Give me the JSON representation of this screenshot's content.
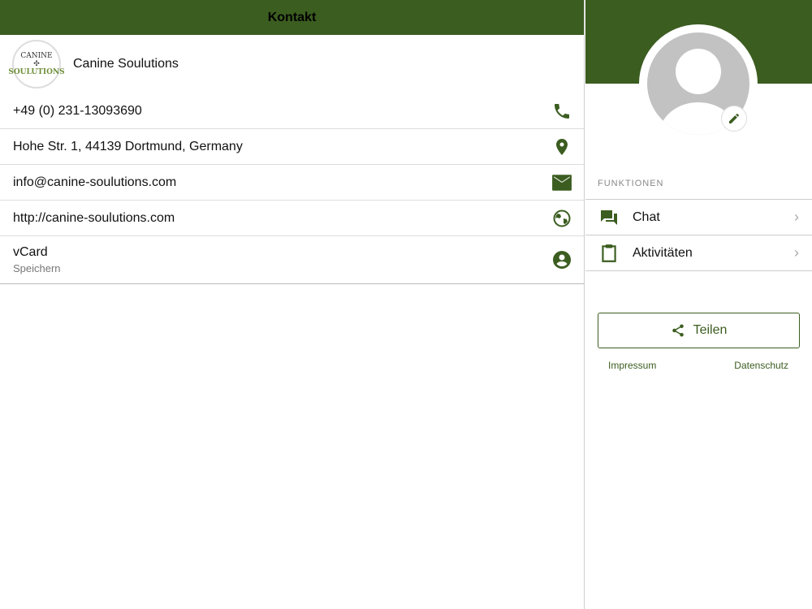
{
  "header": {
    "title": "Kontakt"
  },
  "company": {
    "name": "Canine Soulutions",
    "logo_text_top": "CANINE",
    "logo_text_bottom": "SOULUTIONS"
  },
  "contacts": [
    {
      "value": "+49 (0) 231-13093690",
      "icon": "phone-icon"
    },
    {
      "value": "Hohe Str. 1, 44139 Dortmund, Germany",
      "icon": "location-icon"
    },
    {
      "value": "info@canine-soulutions.com",
      "icon": "mail-icon"
    },
    {
      "value": "http://canine-soulutions.com",
      "icon": "globe-icon"
    }
  ],
  "vcard": {
    "label": "vCard",
    "sub": "Speichern",
    "icon": "account-circle-icon"
  },
  "sidebar": {
    "section": "FUNKTIONEN",
    "items": [
      {
        "label": "Chat",
        "icon": "chat-icon"
      },
      {
        "label": "Aktivitäten",
        "icon": "clipboard-icon"
      }
    ],
    "share": "Teilen",
    "impressum": "Impressum",
    "datenschutz": "Datenschutz"
  },
  "colors": {
    "brand": "#3b5d20"
  }
}
